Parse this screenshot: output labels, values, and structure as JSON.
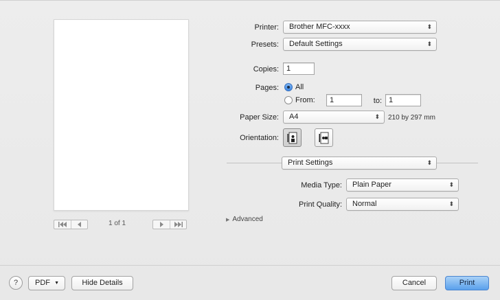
{
  "printer": {
    "label": "Printer:",
    "value": "Brother MFC-xxxx"
  },
  "presets": {
    "label": "Presets:",
    "value": "Default Settings"
  },
  "copies": {
    "label": "Copies:",
    "value": "1"
  },
  "pages": {
    "label": "Pages:",
    "all_label": "All",
    "from_label": "From:",
    "from_value": "1",
    "to_label": "to:",
    "to_value": "1",
    "selected": "All"
  },
  "paper_size": {
    "label": "Paper Size:",
    "value": "A4",
    "dimensions": "210 by 297 mm"
  },
  "orientation": {
    "label": "Orientation:",
    "selected": "portrait"
  },
  "section": {
    "value": "Print Settings"
  },
  "media_type": {
    "label": "Media Type:",
    "value": "Plain Paper"
  },
  "print_quality": {
    "label": "Print Quality:",
    "value": "Normal"
  },
  "advanced": {
    "label": "Advanced"
  },
  "preview_nav": {
    "page_counter": "1 of 1"
  },
  "footer": {
    "help_symbol": "?",
    "pdf_label": "PDF",
    "hide_details_label": "Hide Details",
    "cancel_label": "Cancel",
    "print_label": "Print"
  },
  "colors": {
    "accent": "#5aa0ec",
    "dialog_bg": "#ececec"
  }
}
